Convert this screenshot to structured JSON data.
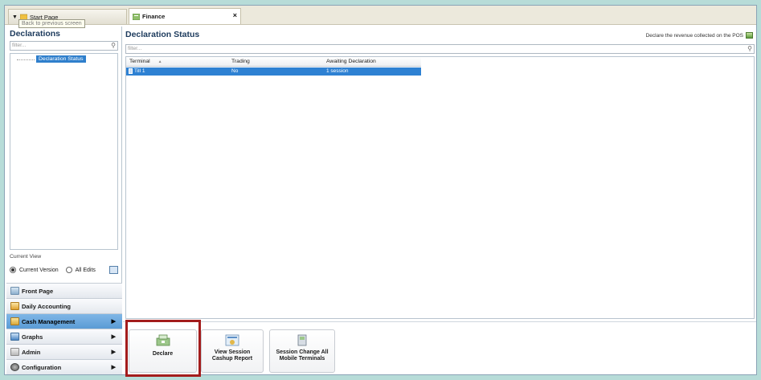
{
  "tabs": {
    "start_page": "Start Page",
    "finance": "Finance",
    "close_symbol": "×",
    "tooltip": "Back to previous screen"
  },
  "left": {
    "title": "Declarations",
    "filter_placeholder": "filter...",
    "tree_item": "Declaration Status",
    "current_view_label": "Current View",
    "radio_current": "Current Version",
    "radio_all": "All Edits"
  },
  "nav": {
    "items": [
      {
        "label": "Front Page",
        "icon": "front-page-icon"
      },
      {
        "label": "Daily Accounting",
        "icon": "daily-accounting-icon"
      },
      {
        "label": "Cash Management",
        "icon": "cash-management-icon"
      },
      {
        "label": "Graphs",
        "icon": "graphs-icon"
      },
      {
        "label": "Admin",
        "icon": "admin-icon"
      },
      {
        "label": "Configuration",
        "icon": "configuration-icon"
      }
    ],
    "selected": "Cash Management"
  },
  "main": {
    "title": "Declaration Status",
    "description": "Declare the revenue collected on the POS",
    "filter_placeholder": "filter...",
    "columns": [
      "Terminal",
      "Trading",
      "Awaiting Declaration"
    ],
    "sort_indicator": "▲",
    "rows": [
      {
        "terminal": "Till 1",
        "trading": "No",
        "awaiting": "1 session"
      }
    ]
  },
  "actions": {
    "declare": "Declare",
    "cashup_report": "View Session Cashup Report",
    "session_change": "Session Change All Mobile Terminals"
  },
  "colors": {
    "selection_blue": "#2e81d3",
    "highlight_red": "#a31c1c",
    "title_navy": "#1c3a5c"
  }
}
